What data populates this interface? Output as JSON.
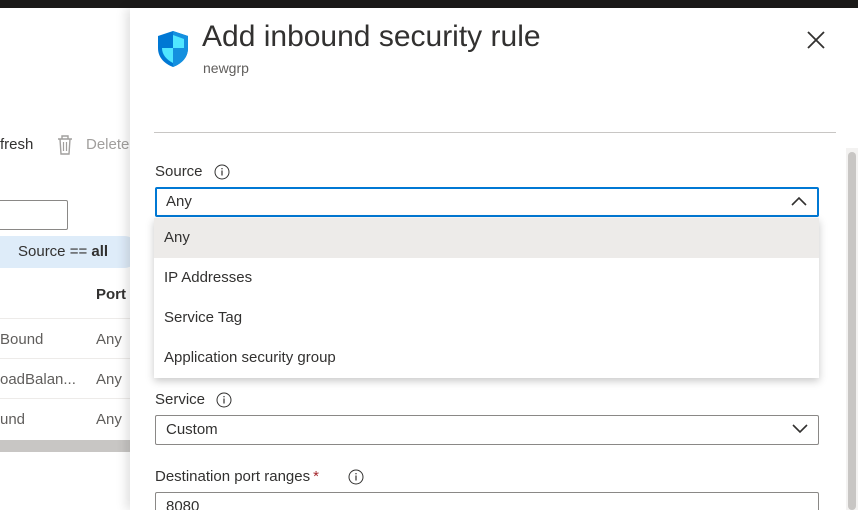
{
  "background": {
    "refresh_label": "fresh",
    "delete_label": "Delete",
    "filter_pill": {
      "field": "Source",
      "op": "==",
      "value": "all"
    },
    "column_port": "Port",
    "rows": [
      {
        "name": "Bound",
        "port": "Any"
      },
      {
        "name": "oadBalan...",
        "port": "Any"
      },
      {
        "name": "und",
        "port": "Any"
      }
    ]
  },
  "panel": {
    "title": "Add inbound security rule",
    "subtitle": "newgrp",
    "icon": "shield-icon",
    "close_icon": "close-icon"
  },
  "form": {
    "source": {
      "label": "Source",
      "value": "Any",
      "options": [
        "Any",
        "IP Addresses",
        "Service Tag",
        "Application security group"
      ],
      "selected_index": 0
    },
    "service": {
      "label": "Service",
      "value": "Custom"
    },
    "destination_port_ranges": {
      "label": "Destination port ranges",
      "required_mark": "*",
      "value": "8080"
    }
  },
  "colors": {
    "accent": "#0078d4",
    "selected_item_bg": "#edebe9",
    "pill_bg": "#deecf9",
    "required": "#a4262c",
    "shield_dark": "#0078d4",
    "shield_light": "#50e6ff"
  }
}
